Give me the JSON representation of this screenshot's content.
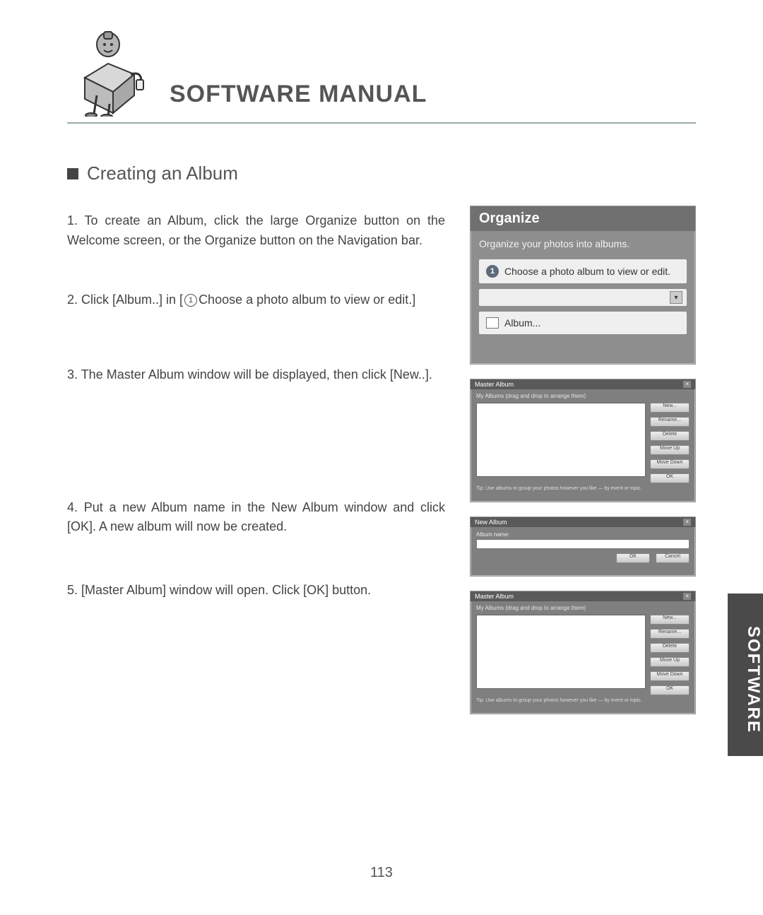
{
  "header": {
    "title": "SOFTWARE MANUAL"
  },
  "section": {
    "heading": "Creating an Album"
  },
  "steps": {
    "s1": "1. To create an Album, click the large Organize button on the Welcome screen, or the Organize button on the Navigation bar.",
    "s2_pre": "2. Click [Album..] in [",
    "s2_circled": "1",
    "s2_post": "Choose a photo album to view or edit.]",
    "s3": "3. The Master Album window will be displayed, then click [New..].",
    "s4": "4. Put a new Album name in the New Album window and click [OK]. A new album will now be created.",
    "s5": "5. [Master Album] window will open. Click [OK] button."
  },
  "panel1": {
    "title": "Organize",
    "subtitle": "Organize your photos into albums.",
    "bullet_num": "1",
    "bullet_text": "Choose a photo album to view or edit.",
    "album_btn": "Album..."
  },
  "master_album": {
    "title": "Master Album",
    "desc": "My Albums (drag and drop to arrange them)",
    "btn_new": "New...",
    "btn_rename": "Rename...",
    "btn_delete": "Delete",
    "btn_up": "Move Up",
    "btn_down": "Move Down",
    "btn_ok": "OK",
    "footnote": "Tip: Use albums to group your photos however you like — by event or topic."
  },
  "new_album": {
    "title": "New Album",
    "label": "Album name:",
    "ok": "OK",
    "cancel": "Cancel"
  },
  "side_tab": "SOFTWARE",
  "page_number": "113"
}
